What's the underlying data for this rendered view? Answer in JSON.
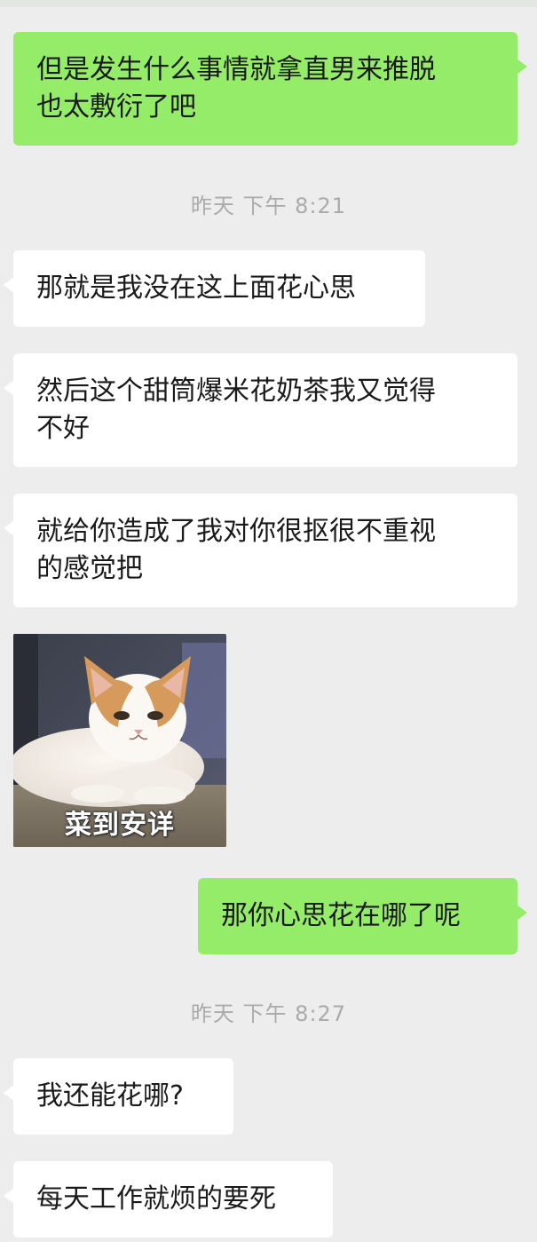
{
  "chat": {
    "messages": [
      {
        "side": "sent",
        "text": "但是发生什么事情就拿直男来推脱\n也太敷衍了吧"
      },
      {
        "timestamp": "昨天 下午 8:21"
      },
      {
        "side": "recv",
        "text": "那就是我没在这上面花心思"
      },
      {
        "side": "recv",
        "text": "然后这个甜筒爆米花奶茶我又觉得\n不好"
      },
      {
        "side": "recv",
        "text": "就给你造成了我对你很抠很不重视\n的感觉把"
      },
      {
        "side": "recv",
        "type": "sticker",
        "caption": "菜到安详"
      },
      {
        "side": "sent",
        "text": "那你心思花在哪了呢"
      },
      {
        "timestamp": "昨天 下午 8:27"
      },
      {
        "side": "recv",
        "text": "我还能花哪?"
      },
      {
        "side": "recv",
        "text": "每天工作就烦的要死"
      }
    ]
  },
  "colors": {
    "background": "#ededed",
    "sent_bubble": "#95ec69",
    "recv_bubble": "#ffffff",
    "timestamp_text": "#ababab"
  }
}
